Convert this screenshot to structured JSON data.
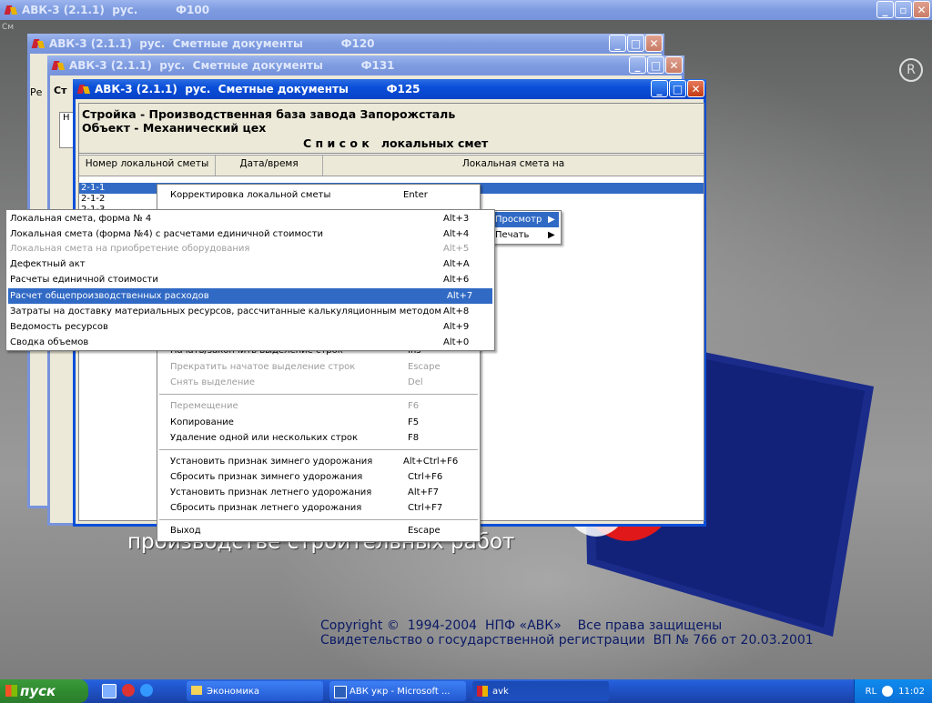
{
  "desktop": {
    "subtitle_text": "производстве строительных работ",
    "copyright_line1": "Copyright ©  1994-2004  НПФ «АВК»    Все права защищены",
    "copyright_line2": "Свидетельство о государственной регистрации  ВП № 766 от 20.03.2001",
    "registered_mark": "R"
  },
  "background_window": {
    "title": "АВК-3 (2.1.1)  рус.          Ф100",
    "side_label": "См"
  },
  "window_f120": {
    "title": "АВК-3 (2.1.1)  рус.  Сметные документы          Ф120",
    "side_text": "Ре",
    "side_text2": "Н",
    "side_text3": "п"
  },
  "window_f131": {
    "title": "АВК-3 (2.1.1)  рус.  Сметные документы          Ф131",
    "side_text": "Ст"
  },
  "window_f125": {
    "title": "АВК-3 (2.1.1)  рус.  Сметные документы          Ф125",
    "header_line1": "Стройка - Производственная база завода Запорожсталь",
    "header_line2": "Объект - Механический цех",
    "list_title": "С п и с о к   локальных смет",
    "columns": [
      "Номер локальной сметы",
      "Дата/время",
      "Локальная смета на"
    ],
    "rows": [
      "2-1-1",
      "2-1-2",
      "2-1-3"
    ]
  },
  "context_menu": {
    "items": [
      {
        "label": "Корректировка локальной сметы",
        "key": "Enter",
        "disabled": false
      },
      {
        "label": "Начать/закончить выделение строк",
        "key": "Ins",
        "disabled": false
      },
      {
        "label": "Прекратить начатое выделение строк",
        "key": "Escape",
        "disabled": true
      },
      {
        "label": "Снять выделение",
        "key": "Del",
        "disabled": true
      },
      {
        "label": "Перемещение",
        "key": "F6",
        "disabled": true
      },
      {
        "label": "Копирование",
        "key": "F5",
        "disabled": false
      },
      {
        "label": "Удаление одной или нескольких строк",
        "key": "F8",
        "disabled": false
      },
      {
        "label": "Установить признак зимнего удорожания",
        "key": "Alt+Ctrl+F6",
        "disabled": false
      },
      {
        "label": "Сбросить признак зимнего удорожания",
        "key": "Ctrl+F6",
        "disabled": false
      },
      {
        "label": "Установить признак летнего удорожания",
        "key": "Alt+F7",
        "disabled": false
      },
      {
        "label": "Сбросить признак летнего удорожания",
        "key": "Ctrl+F7",
        "disabled": false
      },
      {
        "label": "Выход",
        "key": "Escape",
        "disabled": false
      }
    ]
  },
  "print_menu": {
    "items": [
      {
        "label": "Просмотр",
        "arrow": "▶"
      },
      {
        "label": "Печать",
        "arrow": "▶"
      }
    ]
  },
  "view_submenu": {
    "items": [
      {
        "label": "Локальная смета, форма № 4",
        "key": "Alt+3",
        "disabled": false,
        "selected": false
      },
      {
        "label": "Локальная смета (форма №4) с расчетами единичной стоимости",
        "key": "Alt+4",
        "disabled": false,
        "selected": false
      },
      {
        "label": "Локальная смета на приобретение оборудования",
        "key": "Alt+5",
        "disabled": true,
        "selected": false
      },
      {
        "label": "Дефектный акт",
        "key": "Alt+A",
        "disabled": false,
        "selected": false
      },
      {
        "label": "Расчеты единичной стоимости",
        "key": "Alt+6",
        "disabled": false,
        "selected": false
      },
      {
        "label": "Расчет общепроизводственных расходов",
        "key": "Alt+7",
        "disabled": false,
        "selected": true
      },
      {
        "label": "Затраты на доставку материальных ресурсов, рассчитанные калькуляционным методом",
        "key": "Alt+8",
        "disabled": false,
        "selected": false
      },
      {
        "label": "Ведомость ресурсов",
        "key": "Alt+9",
        "disabled": false,
        "selected": false
      },
      {
        "label": "Сводка объемов",
        "key": "Alt+0",
        "disabled": false,
        "selected": false
      }
    ]
  },
  "taskbar": {
    "start_label": "пуск",
    "buttons": [
      "Экономика",
      "АВК укр - Microsoft ...",
      "avk"
    ],
    "tray_lang": "RL",
    "clock": "11:02"
  }
}
